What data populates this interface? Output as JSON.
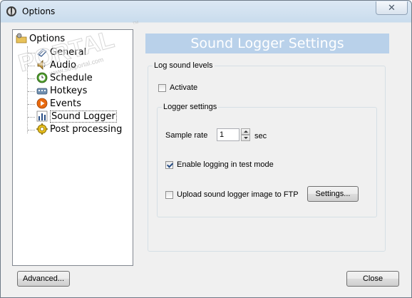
{
  "window": {
    "title": "Options",
    "close_symbol": "✕"
  },
  "watermark": {
    "main": "PORTAL",
    "trademark": "™",
    "url": "www.softportal.com"
  },
  "tree": {
    "root": "Options",
    "items": [
      {
        "label": "General",
        "icon": "general-icon"
      },
      {
        "label": "Audio",
        "icon": "audio-icon"
      },
      {
        "label": "Schedule",
        "icon": "schedule-icon"
      },
      {
        "label": "Hotkeys",
        "icon": "hotkeys-icon"
      },
      {
        "label": "Events",
        "icon": "events-icon"
      },
      {
        "label": "Sound Logger",
        "icon": "sound-logger-icon",
        "selected": true
      },
      {
        "label": "Post processing",
        "icon": "post-processing-icon"
      }
    ]
  },
  "settings": {
    "header": "Sound Logger Settings",
    "log_group": "Log sound levels",
    "activate_label": "Activate",
    "activate_checked": false,
    "logger_group": "Logger settings",
    "sample_rate_label": "Sample rate",
    "sample_rate_value": "1",
    "sample_rate_unit": "sec",
    "test_mode_label": "Enable logging in test mode",
    "test_mode_checked": true,
    "upload_label": "Upload sound logger image to FTP",
    "upload_checked": false,
    "settings_button": "Settings..."
  },
  "footer": {
    "advanced_button": "Advanced...",
    "close_button": "Close"
  }
}
